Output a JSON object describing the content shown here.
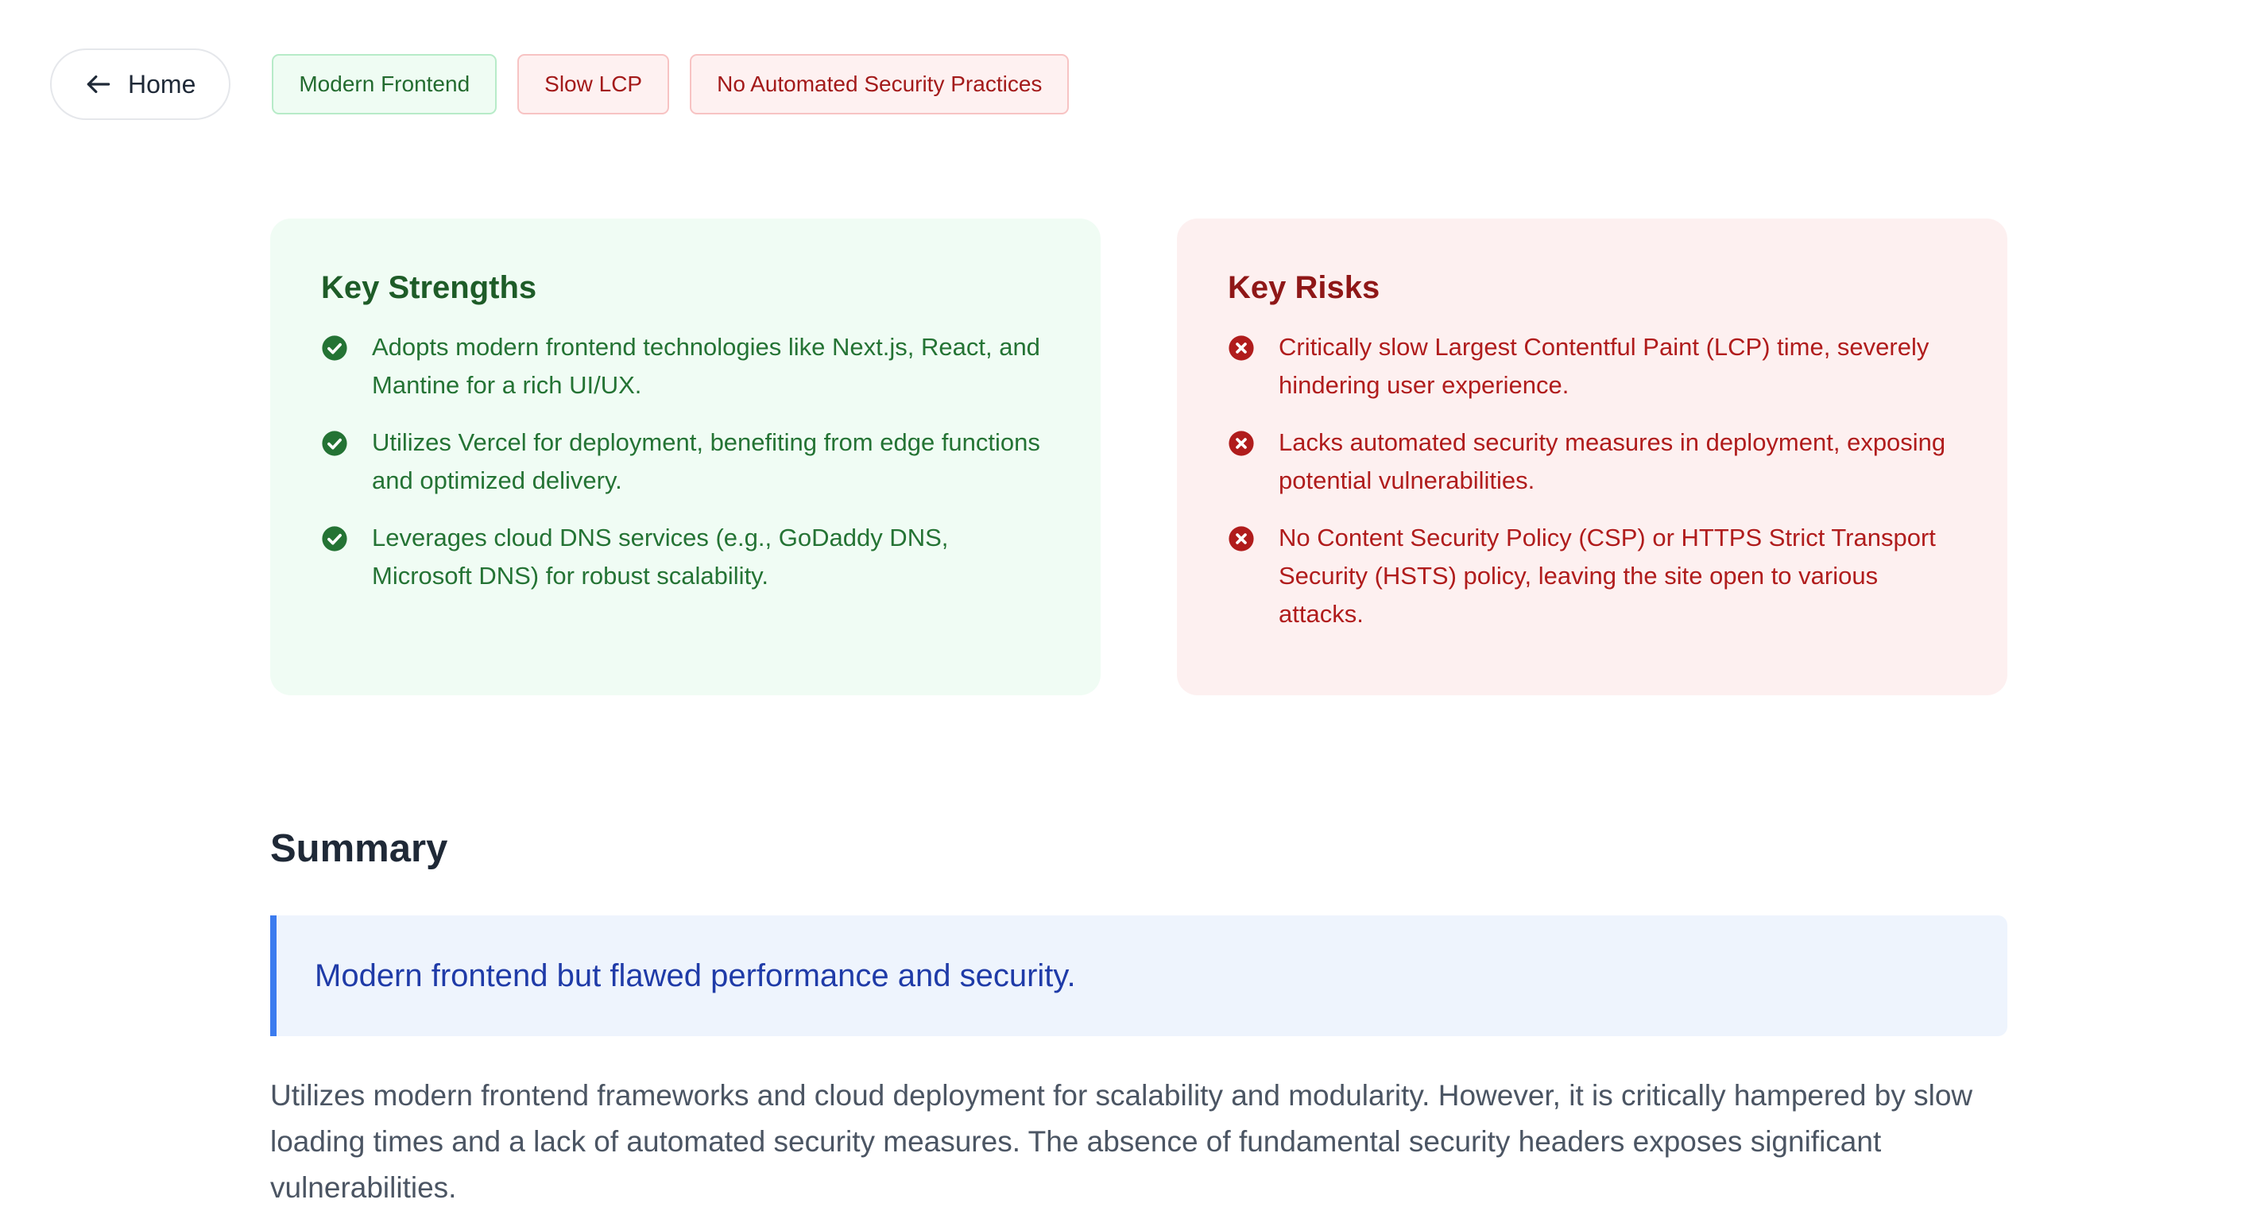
{
  "nav": {
    "home_label": "Home"
  },
  "tags": [
    {
      "label": "Modern Frontend",
      "tone": "positive"
    },
    {
      "label": "Slow LCP",
      "tone": "negative"
    },
    {
      "label": "No Automated Security Practices",
      "tone": "negative"
    }
  ],
  "strengths": {
    "title": "Key Strengths",
    "icon": "check-circle-icon",
    "items": [
      "Adopts modern frontend technologies like Next.js, React, and Mantine for a rich UI/UX.",
      "Utilizes Vercel for deployment, benefiting from edge functions and optimized delivery.",
      "Leverages cloud DNS services (e.g., GoDaddy DNS, Microsoft DNS) for robust scalability."
    ]
  },
  "risks": {
    "title": "Key Risks",
    "icon": "x-circle-icon",
    "items": [
      "Critically slow Largest Contentful Paint (LCP) time, severely hindering user experience.",
      "Lacks automated security measures in deployment, exposing potential vulnerabilities.",
      "No Content Security Policy (CSP) or HTTPS Strict Transport Security (HSTS) policy, leaving the site open to various attacks."
    ]
  },
  "summary": {
    "title": "Summary",
    "callout": "Modern frontend but flawed performance and security.",
    "body": "Utilizes modern frontend frameworks and cloud deployment for scalability and modularity. However, it is critically hampered by slow loading times and a lack of automated security measures. The absence of fundamental security headers exposes significant vulnerabilities."
  },
  "colors": {
    "positive": "#247334",
    "negative": "#b01c1c",
    "accent": "#3b7bef"
  }
}
